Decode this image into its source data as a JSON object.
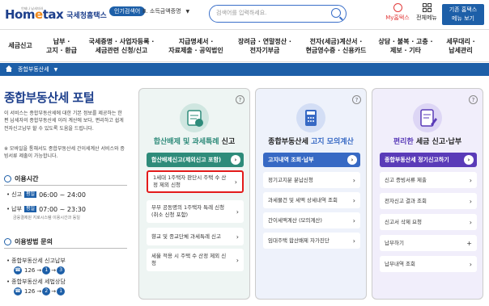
{
  "header": {
    "logo_text_a": "Hom",
    "logo_text_e": "e",
    "logo_text_b": "tax",
    "logo_sub": "국세청홈택스",
    "logo_tiny": "언제나 납세자와",
    "popular_label": "인기검색어",
    "popular_item": "8. 소득금액증명",
    "search_placeholder": "검색어를 입력하세요.",
    "my_label": "My홈택스",
    "allmenu_label": "전체메뉴",
    "old_btn_l1": "기존 홈택스",
    "old_btn_l2": "메뉴 보기"
  },
  "nav": {
    "items": [
      {
        "l1": "세금신고",
        "l2": ""
      },
      {
        "l1": "납부 ·",
        "l2": "고지 · 환급"
      },
      {
        "l1": "국세증명 · 사업자등록 ·",
        "l2": "세금관련 신청/신고"
      },
      {
        "l1": "지급명세서 ·",
        "l2": "자료제출 · 공익법인"
      },
      {
        "l1": "장려금 · 연말정산 ·",
        "l2": "전자기부금"
      },
      {
        "l1": "전자(세금)계산서 ·",
        "l2": "현금영수증 · 신용카드"
      },
      {
        "l1": "상담 · 불복 · 고충 ·",
        "l2": "제보 · 기타"
      },
      {
        "l1": "세무대리 ·",
        "l2": "납세관리"
      }
    ]
  },
  "breadcrumb": {
    "label": "종합부동산세"
  },
  "left": {
    "title": "종합부동산세 포털",
    "desc": "이 서비스는 종합부동산세에 대한 기본 정보를 제공하는 한편 납세자의 종합부동산세 이러 계산에 보다, 편리하고 쉽게 전자신고납부 할 수 있도록 도움을 드립니다.",
    "note": "※ 모바일을 통해서도 종합부동산세 간이세계산 서비스와 증빙서류 제출이 가능합니다.",
    "hours_title": "이용시간",
    "hours": [
      {
        "label": "신고",
        "tag": "평일",
        "time": "06:00 ~ 24:00"
      },
      {
        "label": "납부",
        "tag": "평일",
        "time": "07:00 ~ 23:30"
      }
    ],
    "hours_note": "금융결제원 지로시스템 이용시간과 동일",
    "inquiry_title": "이용방법 문의",
    "inquiries": [
      {
        "label": "종합부동산세 신고납부",
        "num": "126",
        "b1": "1",
        "b2": "3"
      },
      {
        "label": "종합부동산세 세법상담",
        "num": "126",
        "b1": "2",
        "b2": "1"
      }
    ]
  },
  "cards": [
    {
      "title_a": "합산배제 및 과세특례",
      "title_b": " 신고",
      "header": "합산배제신고(제외신고 포함)",
      "items": [
        "1세대 1주택자 판단시 주택 수 산정 제외 신청",
        "부부 공동명의 1주택자 특례 신청(취소 신청 포함)",
        "향교 및 종교단체 과세특례 신고",
        "세율 적용 시 주택 수 산정 제외 신청"
      ]
    },
    {
      "title_a": "종합부동산세",
      "title_b": " 고지 모의계산",
      "header": "고지내역 조회·납부",
      "items": [
        "정기고지분 분납신청",
        "과세물건 및 세액 상세내역 조회",
        "간이세액계산 (모의계산)",
        "임대주택 합산배제 자가진단"
      ]
    },
    {
      "title_a": "편리한",
      "title_b": " 세금 신고·납부",
      "header": "종합부동산세 정기신고하기",
      "items": [
        "신고 증빙서류 제출",
        "전자신고 결과 조회",
        "신고서 삭제 요청",
        "납부하기",
        "납부내역 조회"
      ]
    }
  ],
  "colors": {
    "accent": "#1d5fa8",
    "card1": "#2e8b7a",
    "card2": "#3769c4",
    "card3": "#5a3bb8",
    "highlight": "#e31b1b"
  }
}
